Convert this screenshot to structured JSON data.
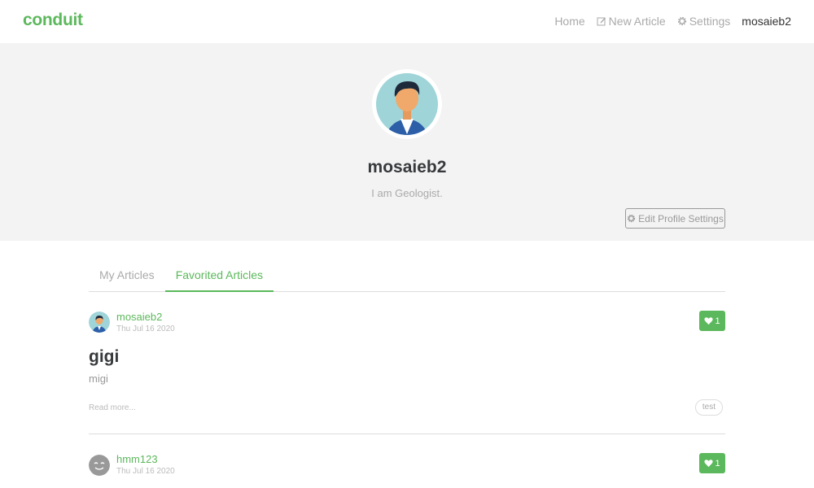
{
  "navbar": {
    "brand": "conduit",
    "links": [
      "Home",
      "New Article",
      "Settings",
      "mosaieb2"
    ],
    "icons": {
      "new_article": "pencil-square-icon",
      "settings": "gear-icon"
    }
  },
  "profile": {
    "username": "mosaieb2",
    "bio": "I am Geologist.",
    "edit_button": "Edit Profile Settings"
  },
  "tabs": [
    "My Articles",
    "Favorited Articles"
  ],
  "articles": [
    {
      "author": "mosaieb2",
      "date": "Thu Jul 16 2020",
      "favorites": "1",
      "title": "gigi",
      "description": "migi",
      "read_more": "Read more...",
      "tags": [
        "test"
      ]
    },
    {
      "author": "hmm123",
      "date": "Thu Jul 16 2020",
      "favorites": "1"
    }
  ],
  "colors": {
    "accent": "#5cb85c",
    "banner": "#f3f3f3"
  }
}
